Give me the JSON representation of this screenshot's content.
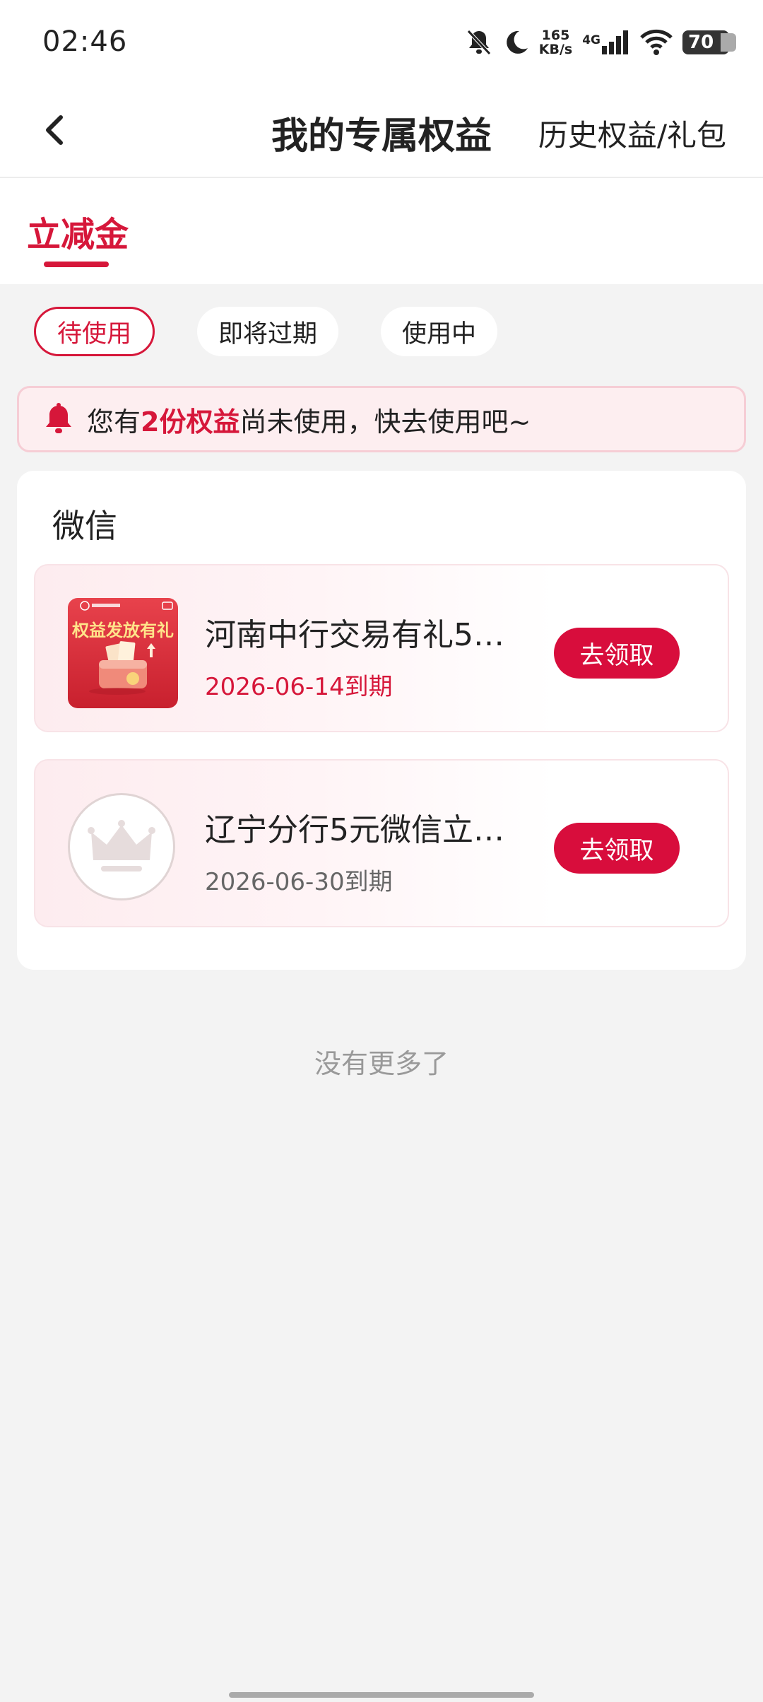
{
  "status_bar": {
    "time": "02:46",
    "speed_value": "165",
    "speed_unit": "KB/s",
    "network": "4G",
    "battery": "70"
  },
  "nav": {
    "title": "我的专属权益",
    "history_link": "历史权益/礼包"
  },
  "tabs": [
    {
      "label": "立减金"
    }
  ],
  "filters": [
    {
      "label": "待使用"
    },
    {
      "label": "即将过期"
    },
    {
      "label": "使用中"
    }
  ],
  "notice": {
    "prefix": "您有",
    "highlight": "2份权益",
    "suffix": "尚未使用，快去使用吧~"
  },
  "card": {
    "title": "微信",
    "items": [
      {
        "thumb_text": "权益发放有礼",
        "name": "河南中行交易有礼5…",
        "date": "2026-06-14到期",
        "action": "去领取"
      },
      {
        "name": "辽宁分行5元微信立…",
        "date": "2026-06-30到期",
        "action": "去领取"
      }
    ]
  },
  "footer": {
    "no_more": "没有更多了"
  },
  "colors": {
    "accent": "#d6173a",
    "button": "#d80d3c",
    "background": "#f3f3f3"
  }
}
